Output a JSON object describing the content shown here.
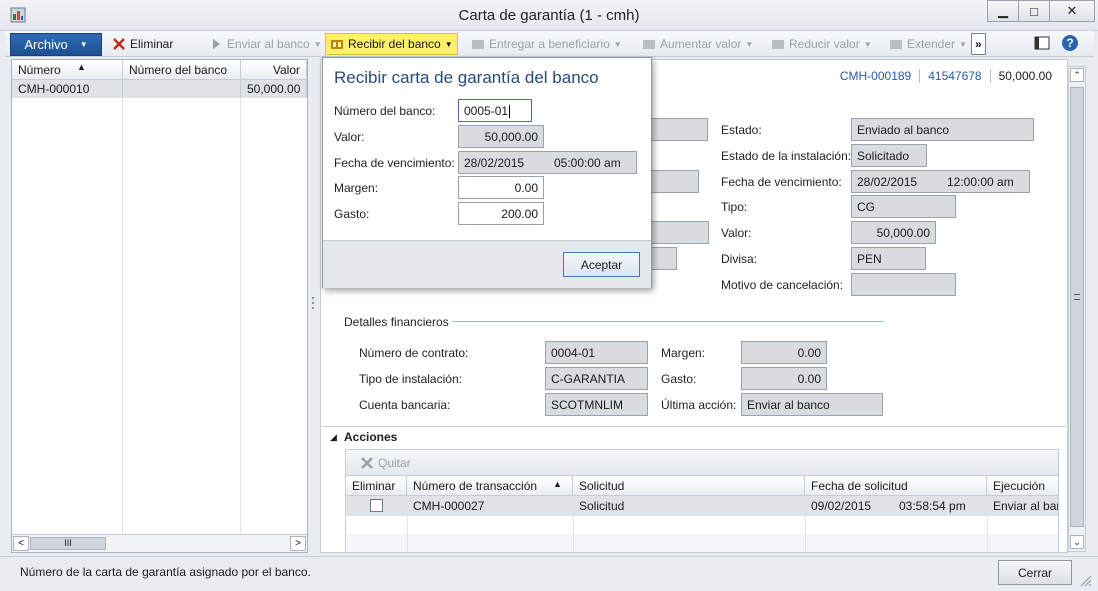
{
  "window": {
    "title": "Carta de garantía (1 - cmh)",
    "minimize": "▁",
    "maximize": "□",
    "close": "✕"
  },
  "toolbar": {
    "archivo": "Archivo",
    "eliminar": "Eliminar",
    "enviar_banco": "Enviar al banco",
    "recibir_banco": "Recibir del banco",
    "entregar_beneficiario": "Entregar a beneficiario",
    "aumentar_valor": "Aumentar valor",
    "reducir_valor": "Reducir valor",
    "extender": "Extender",
    "overflow": "»"
  },
  "list": {
    "headers": [
      "Número",
      "Número del banco",
      "Valor"
    ],
    "rows": [
      {
        "numero": "CMH-000010",
        "numero_banco": "",
        "valor": "50,000.00"
      }
    ],
    "scroll_thumb": "III"
  },
  "header_ids": {
    "carta": "CMH-000189",
    "numero": "41547678",
    "valor": "50,000.00"
  },
  "details": {
    "estado_label": "Estado:",
    "estado_value": "Enviado al banco",
    "estado_inst_label": "Estado de la instalación:",
    "estado_inst_value": "Solicitado",
    "fecha_venc_label": "Fecha de vencimiento:",
    "fecha_venc_date": "28/02/2015",
    "fecha_venc_time": "12:00:00 am",
    "tipo_label": "Tipo:",
    "tipo_value": "CG",
    "valor_label": "Valor:",
    "valor_value": "50,000.00",
    "divisa_label": "Divisa:",
    "divisa_value": "PEN",
    "motivo_label": "Motivo de cancelación:",
    "motivo_value": ""
  },
  "financieros": {
    "title": "Detalles financieros",
    "contrato_label": "Número de contrato:",
    "contrato_value": "0004-01",
    "instalacion_label": "Tipo de instalación:",
    "instalacion_value": "C-GARANTIA",
    "cuenta_label": "Cuenta bancaria:",
    "cuenta_value": "SCOTMNLIM",
    "margen_label": "Margen:",
    "margen_value": "0.00",
    "gasto_label": "Gasto:",
    "gasto_value": "0.00",
    "ultima_label": "Última acción:",
    "ultima_value": "Enviar al banco"
  },
  "acciones": {
    "title": "Acciones",
    "quitar": "Quitar",
    "headers": [
      "Eliminar",
      "Número de transacción",
      "Solicitud",
      "Fecha de solicitud",
      "Ejecución"
    ],
    "rows": [
      {
        "numero": "CMH-000027",
        "solicitud": "Solicitud",
        "fecha": "09/02/2015",
        "hora": "03:58:54 pm",
        "ejecucion": "Enviar al ban"
      }
    ]
  },
  "popup": {
    "title": "Recibir carta de garantía del banco",
    "numero_banco_label": "Número del banco:",
    "numero_banco_value": "0005-01",
    "valor_label": "Valor:",
    "valor_value": "50,000.00",
    "fecha_label": "Fecha de vencimiento:",
    "fecha_date": "28/02/2015",
    "fecha_time": "05:00:00 am",
    "margen_label": "Margen:",
    "margen_value": "0.00",
    "gasto_label": "Gasto:",
    "gasto_value": "200.00",
    "aceptar": "Aceptar"
  },
  "status": {
    "text": "Número de la carta de garantía asignado por el banco.",
    "cerrar": "Cerrar"
  },
  "colors": {
    "accent": "#1d4f93",
    "highlight": "#fff06a",
    "field_bg": "#d9dcdf",
    "popup_title": "#2a4a7a"
  },
  "icons": [
    "app-icon",
    "delete-x-icon",
    "send-arrow-icon",
    "receive-bank-icon",
    "deliver-icon",
    "increase-icon",
    "reduce-icon",
    "extend-icon",
    "layout-icon",
    "help-icon",
    "sort-up-icon",
    "collapse-triangle-icon",
    "remove-x-icon"
  ]
}
